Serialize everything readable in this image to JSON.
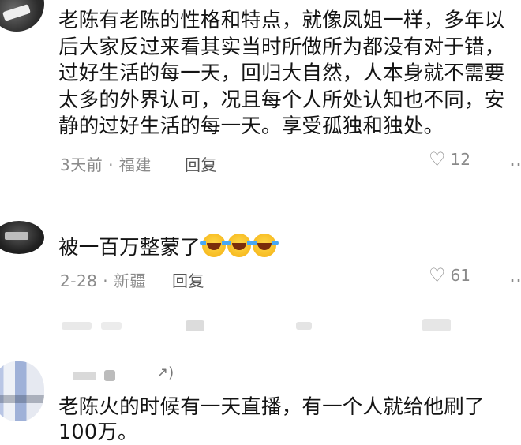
{
  "comments": [
    {
      "text_lines": [
        "老陈有老陈的性格和特点，就像凤姐一样，多年以",
        "后大家反过来看其实当时所做所为都没有对于错，",
        "过好生活的每一天，回归大自然，人本身就不需要",
        "太多的外界认可，况且每个人所处认知也不同，安",
        "静的过好生活的每一天。享受孤独和独处。"
      ],
      "time_location": "3天前 · 福建",
      "reply_label": "回复",
      "likes": "12"
    },
    {
      "text": "被一百万整蒙了",
      "emoji_count": 3,
      "emoji_name": "laughing-crying-emoji",
      "time_location": "2-28 · 新疆",
      "reply_label": "回复",
      "likes": "61"
    },
    {
      "author_badge": "↗)",
      "text_lines": [
        "老陈火的时候有一天直播，有一个人就给他刷了",
        "100万。"
      ]
    }
  ],
  "icons": {
    "heart": "heart-outline-icon",
    "more": "more-icon"
  },
  "colors": {
    "text": "#141414",
    "meta": "#8a8a8a"
  }
}
